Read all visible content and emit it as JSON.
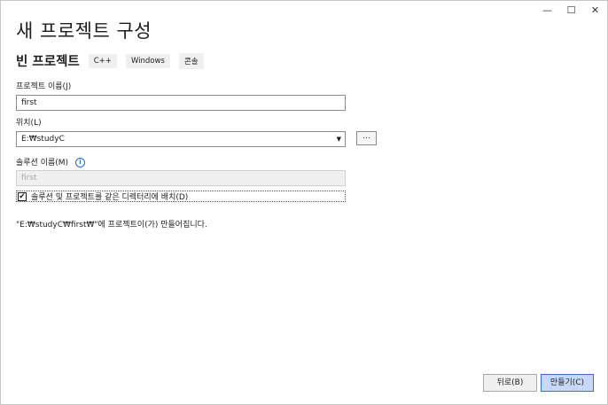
{
  "window": {
    "title": "새 프로젝트 구성",
    "controls": {
      "minimize": "—",
      "maximize": "☐",
      "close": "✕"
    }
  },
  "template": {
    "name": "빈 프로젝트",
    "tags": [
      "C++",
      "Windows",
      "콘솔"
    ]
  },
  "project_name": {
    "label": "프로젝트 이름(J)",
    "value": "first"
  },
  "location": {
    "label": "위치(L)",
    "value": "E:₩studyC",
    "browse_label": "..."
  },
  "solution_name": {
    "label": "솔루션 이름(M)",
    "info_icon": "i",
    "placeholder": "first"
  },
  "same_directory": {
    "checked": true,
    "check_glyph": "✔",
    "label": "솔루션 및 프로젝트를 같은 디렉터리에 배치(D)"
  },
  "path_message": "\"E:₩studyC₩first₩\"에 프로젝트이(가) 만들어집니다.",
  "buttons": {
    "back": "뒤로(B)",
    "create": "만들기(C)"
  }
}
